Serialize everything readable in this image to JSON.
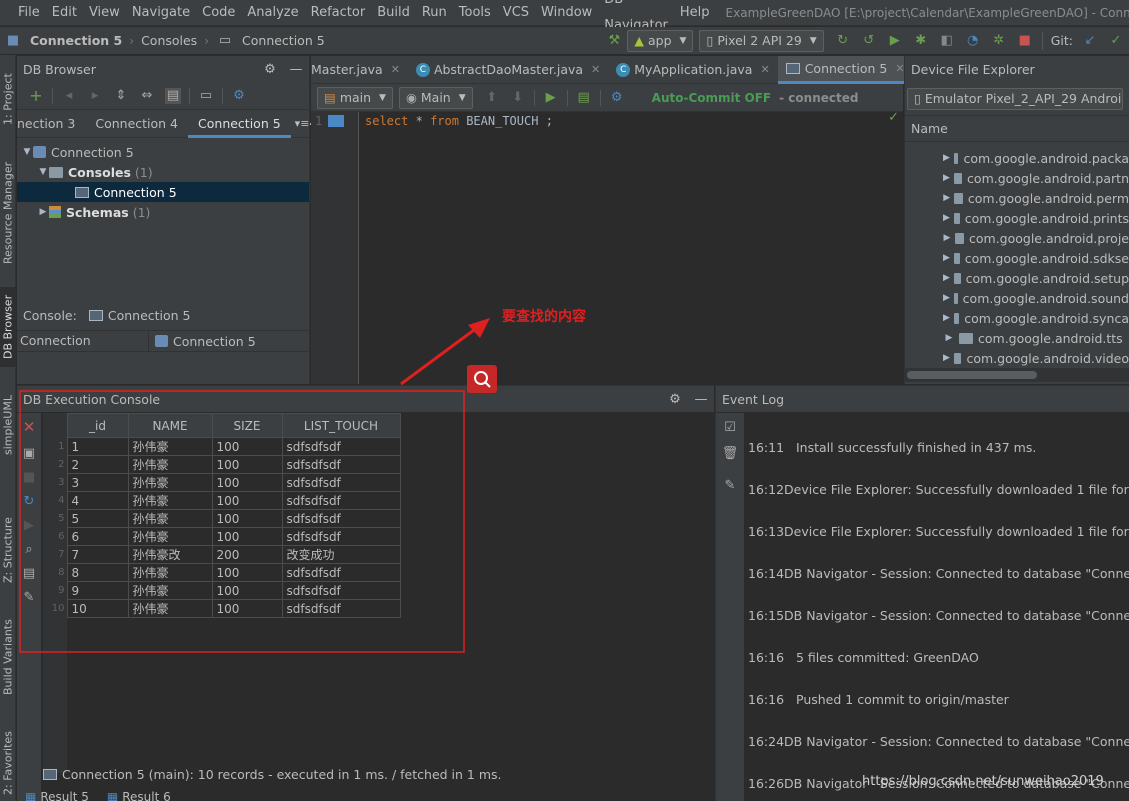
{
  "menubar": {
    "items": [
      "File",
      "Edit",
      "View",
      "Navigate",
      "Code",
      "Analyze",
      "Refactor",
      "Build",
      "Run",
      "Tools",
      "VCS",
      "Window",
      "DB Navigator",
      "Help"
    ],
    "title": "ExampleGreenDAO [E:\\project\\Calendar\\ExampleGreenDAO] - Connectio"
  },
  "navbar": {
    "crumb_root": "Connection 5",
    "crumb_consoles": "Consoles",
    "crumb_leaf": "Connection 5",
    "run_config": "app",
    "device": "Pixel 2 API 29",
    "git_label": "Git:"
  },
  "left_stripe": {
    "tabs": [
      "1: Project",
      "Resource Manager",
      "DB Browser",
      "simpleUML",
      "Z: Structure",
      "Build Variants",
      "2: Favorites"
    ]
  },
  "db_browser": {
    "title": "DB Browser",
    "subtabs": [
      "nection 3",
      "Connection 4",
      "Connection 5"
    ],
    "tree": {
      "root": "Connection 5",
      "consoles": "Consoles",
      "consoles_count": "(1)",
      "console_item": "Connection 5",
      "schemas": "Schemas",
      "schemas_count": "(1)"
    },
    "console_label": "Console:",
    "console_value": "Connection 5",
    "conn_col_label": "Connection",
    "conn_col_value": "Connection 5"
  },
  "editor": {
    "tabs": [
      {
        "label": "Master.java"
      },
      {
        "label": "AbstractDaoMaster.java"
      },
      {
        "label": "MyApplication.java"
      },
      {
        "label": "Connection 5"
      }
    ],
    "tabs_overflow": "5",
    "schema_combo": "main",
    "session_combo": "Main",
    "autocommit": "Auto-Commit OFF",
    "status": "- connected",
    "line_no": "1",
    "code": {
      "kw1": "select",
      "star": "*",
      "kw2": "from",
      "table": "BEAN_TOUCH",
      "end": ";"
    }
  },
  "annotation": {
    "text": "要查找的内容",
    "color": "#e02020"
  },
  "device_explorer": {
    "title": "Device File Explorer",
    "device": "Emulator Pixel_2_API_29 Android 1",
    "column": "Name",
    "rows": [
      "com.google.android.packa",
      "com.google.android.partn",
      "com.google.android.perm",
      "com.google.android.prints",
      "com.google.android.proje",
      "com.google.android.sdkse",
      "com.google.android.setup",
      "com.google.android.sound",
      "com.google.android.synca",
      "com.google.android.tts",
      "com.google.android.video"
    ]
  },
  "exec_console": {
    "title": "DB Execution Console",
    "columns": [
      "_id",
      "NAME",
      "SIZE",
      "LIST_TOUCH"
    ],
    "rows": [
      [
        "1",
        "1",
        "孙伟豪",
        "100",
        "sdfsdfsdf"
      ],
      [
        "2",
        "2",
        "孙伟豪",
        "100",
        "sdfsdfsdf"
      ],
      [
        "3",
        "3",
        "孙伟豪",
        "100",
        "sdfsdfsdf"
      ],
      [
        "4",
        "4",
        "孙伟豪",
        "100",
        "sdfsdfsdf"
      ],
      [
        "5",
        "5",
        "孙伟豪",
        "100",
        "sdfsdfsdf"
      ],
      [
        "6",
        "6",
        "孙伟豪",
        "100",
        "sdfsdfsdf"
      ],
      [
        "7",
        "7",
        "孙伟豪改",
        "200",
        "改变成功"
      ],
      [
        "8",
        "8",
        "孙伟豪",
        "100",
        "sdfsdfsdf"
      ],
      [
        "9",
        "9",
        "孙伟豪",
        "100",
        "sdfsdfsdf"
      ],
      [
        "10",
        "10",
        "孙伟豪",
        "100",
        "sdfsdfsdf"
      ]
    ],
    "status": "Connection 5 (main): 10 records   - executed in 1 ms. / fetched in 1 ms.",
    "result_tabs": [
      "Result 5",
      "Result 6"
    ]
  },
  "event_log": {
    "title": "Event Log",
    "entries": [
      {
        "time": "16:11",
        "msg": "Install successfully finished in 437 ms."
      },
      {
        "time": "16:12",
        "msg": "Device File Explorer: Successfully downloaded 1 file for a"
      },
      {
        "time": "16:13",
        "msg": "Device File Explorer: Successfully downloaded 1 file for a"
      },
      {
        "time": "16:14",
        "msg": "DB Navigator - Session: Connected to database \"Connect"
      },
      {
        "time": "16:15",
        "msg": "DB Navigator - Session: Connected to database \"Connect"
      },
      {
        "time": "16:16",
        "msg": "5 files committed: GreenDAO"
      },
      {
        "time": "16:16",
        "msg": "Pushed 1 commit to origin/master"
      },
      {
        "time": "16:24",
        "msg": "DB Navigator - Session: Connected to database \"Connect"
      },
      {
        "time": "16:26",
        "msg": "DB Navigator - Session: Connected to database \"Connect"
      }
    ],
    "watermark": "https://blog.csdn.net/sunweihao2019"
  },
  "colors": {
    "accent": "#4a88c7",
    "connected_green": "#6a9f4c",
    "autocommit": "#499c54",
    "annotation_red": "#e02020"
  }
}
